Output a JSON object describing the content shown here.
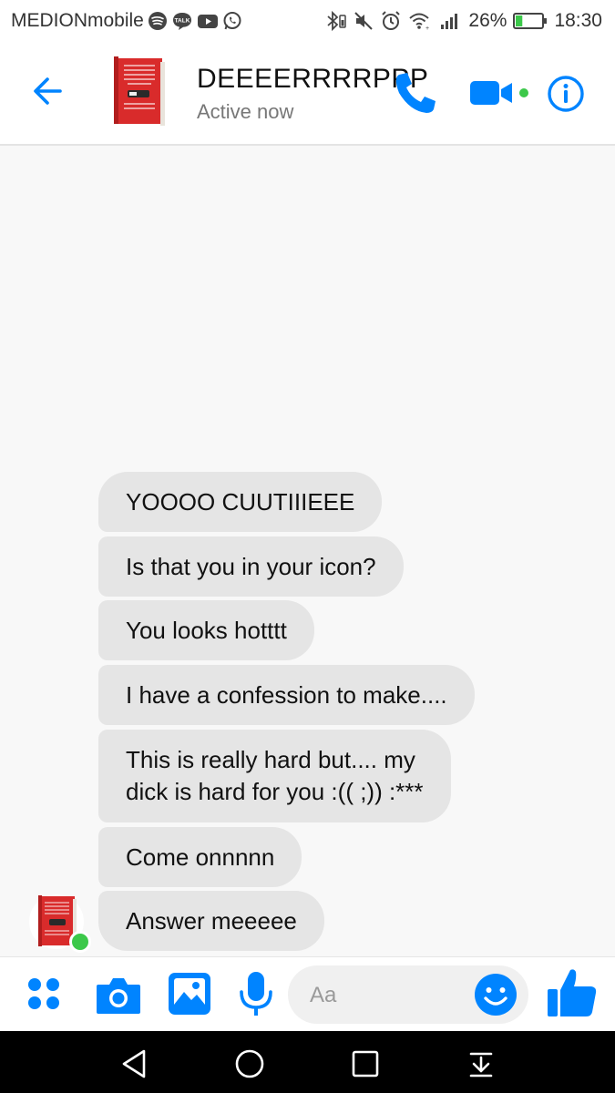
{
  "status_bar": {
    "carrier": "MEDIONmobile",
    "left_icons": [
      "spotify-icon",
      "talk-icon",
      "youtube-icon",
      "whatsapp-icon"
    ],
    "right_icons": [
      "bluetooth-icon",
      "mute-icon",
      "alarm-icon",
      "wifi-icon",
      "signal-icon"
    ],
    "battery_percent": "26%",
    "battery_level": 0.26,
    "time": "18:30"
  },
  "header": {
    "back_icon": "back-arrow-icon",
    "contact_name": "DEEEERRRRPPP",
    "status": "Active now",
    "actions": [
      "phone-icon",
      "video-camera-icon",
      "info-icon"
    ]
  },
  "colors": {
    "accent": "#0084ff",
    "online": "#3cc84a",
    "bubble": "#e5e5e5",
    "background": "#f8f8f8"
  },
  "messages": [
    {
      "text": "YOOOO CUUTIIIEEE"
    },
    {
      "text": "Is that you in your icon?"
    },
    {
      "text": "You looks hotttt"
    },
    {
      "text": "I have a confession to make...."
    },
    {
      "text": "This is really hard but.... my\ndick is hard for you :(( ;)) :***"
    },
    {
      "text": "Come onnnnn"
    },
    {
      "text": "Answer meeeee"
    }
  ],
  "composer": {
    "placeholder": "Aa",
    "buttons": [
      "menu-dots-icon",
      "camera-icon",
      "gallery-icon",
      "microphone-icon",
      "emoji-icon",
      "thumbs-up-icon"
    ]
  },
  "nav_bar": {
    "buttons": [
      "nav-back-icon",
      "nav-home-icon",
      "nav-recents-icon",
      "nav-notifications-icon"
    ]
  }
}
